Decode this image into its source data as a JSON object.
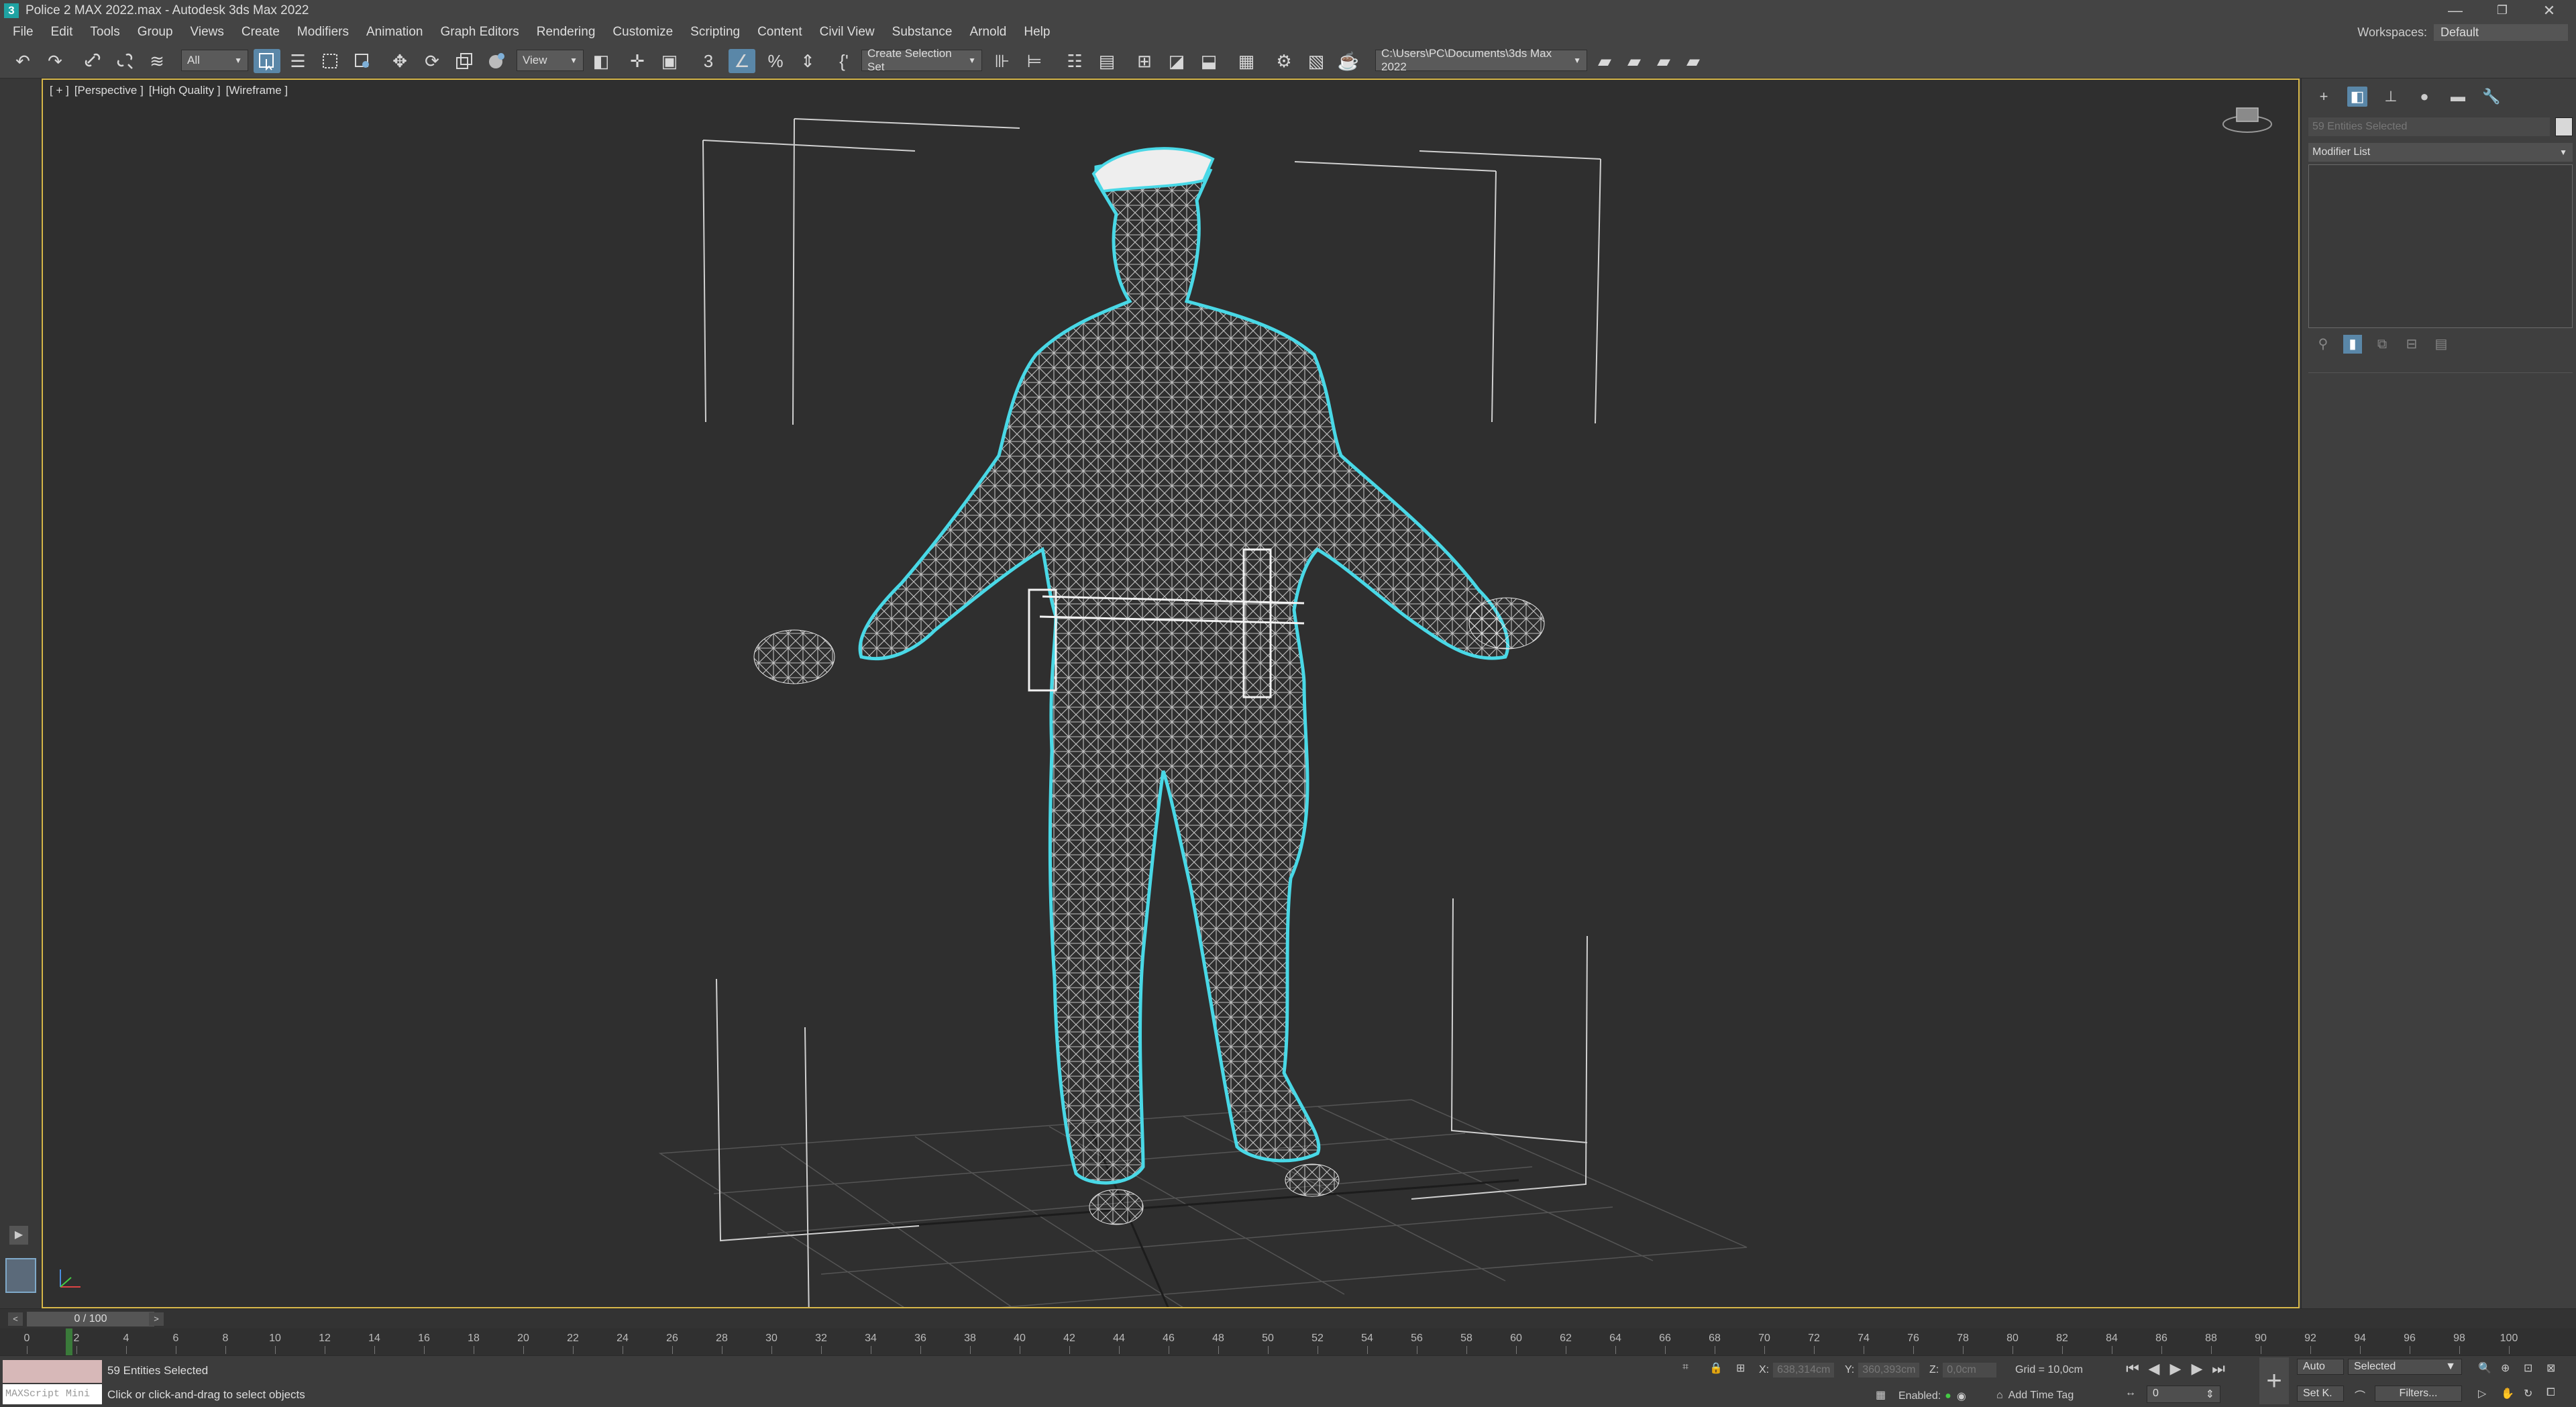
{
  "window": {
    "title": "Police 2 MAX 2022.max - Autodesk 3ds Max 2022",
    "app_icon": "3",
    "controls": [
      "—",
      "❐",
      "✕"
    ]
  },
  "menu": [
    "File",
    "Edit",
    "Tools",
    "Group",
    "Views",
    "Create",
    "Modifiers",
    "Animation",
    "Graph Editors",
    "Rendering",
    "Customize",
    "Scripting",
    "Content",
    "Civil View",
    "Substance",
    "Arnold",
    "Help"
  ],
  "workspace": {
    "label": "Workspaces:",
    "value": "Default"
  },
  "toolbar": {
    "selection_filter": "All",
    "ref_coord": "View",
    "named_selection": "Create Selection Set",
    "project_path": "C:\\Users\\PC\\Documents\\3ds Max 2022"
  },
  "viewport": {
    "labels": [
      "[ + ]",
      "[Perspective ]",
      "[High Quality ]",
      "[Wireframe ]"
    ],
    "scene": "wireframe police officer model with cyan selection outline"
  },
  "command_panel": {
    "selection_name": "59 Entities Selected",
    "modifier_list": "Modifier List"
  },
  "timeline": {
    "frame": "0 / 100",
    "ticks": [
      0,
      2,
      4,
      6,
      8,
      10,
      12,
      14,
      16,
      18,
      20,
      22,
      24,
      26,
      28,
      30,
      32,
      34,
      36,
      38,
      40,
      42,
      44,
      46,
      48,
      50,
      52,
      54,
      56,
      58,
      60,
      62,
      64,
      66,
      68,
      70,
      72,
      74,
      76,
      78,
      80,
      82,
      84,
      86,
      88,
      90,
      92,
      94,
      96,
      98,
      100
    ]
  },
  "status": {
    "selected": "59 Entities Selected",
    "prompt": "Click or click-and-drag to select objects",
    "maxscript": "MAXScript Mini",
    "x": "638,314cm",
    "y": "360,393cm",
    "z": "0,0cm",
    "grid": "Grid = 10,0cm",
    "enabled": "Enabled:",
    "time_tag": "Add Time Tag",
    "key_mode": "Auto",
    "key_filter": "Selected",
    "set_key": "Set K.",
    "filters": "Filters...",
    "current_frame": "0"
  },
  "colors": {
    "accent": "#5a87a8",
    "selection_outline": "#49d8e6",
    "viewport_border": "#d8b84a"
  }
}
